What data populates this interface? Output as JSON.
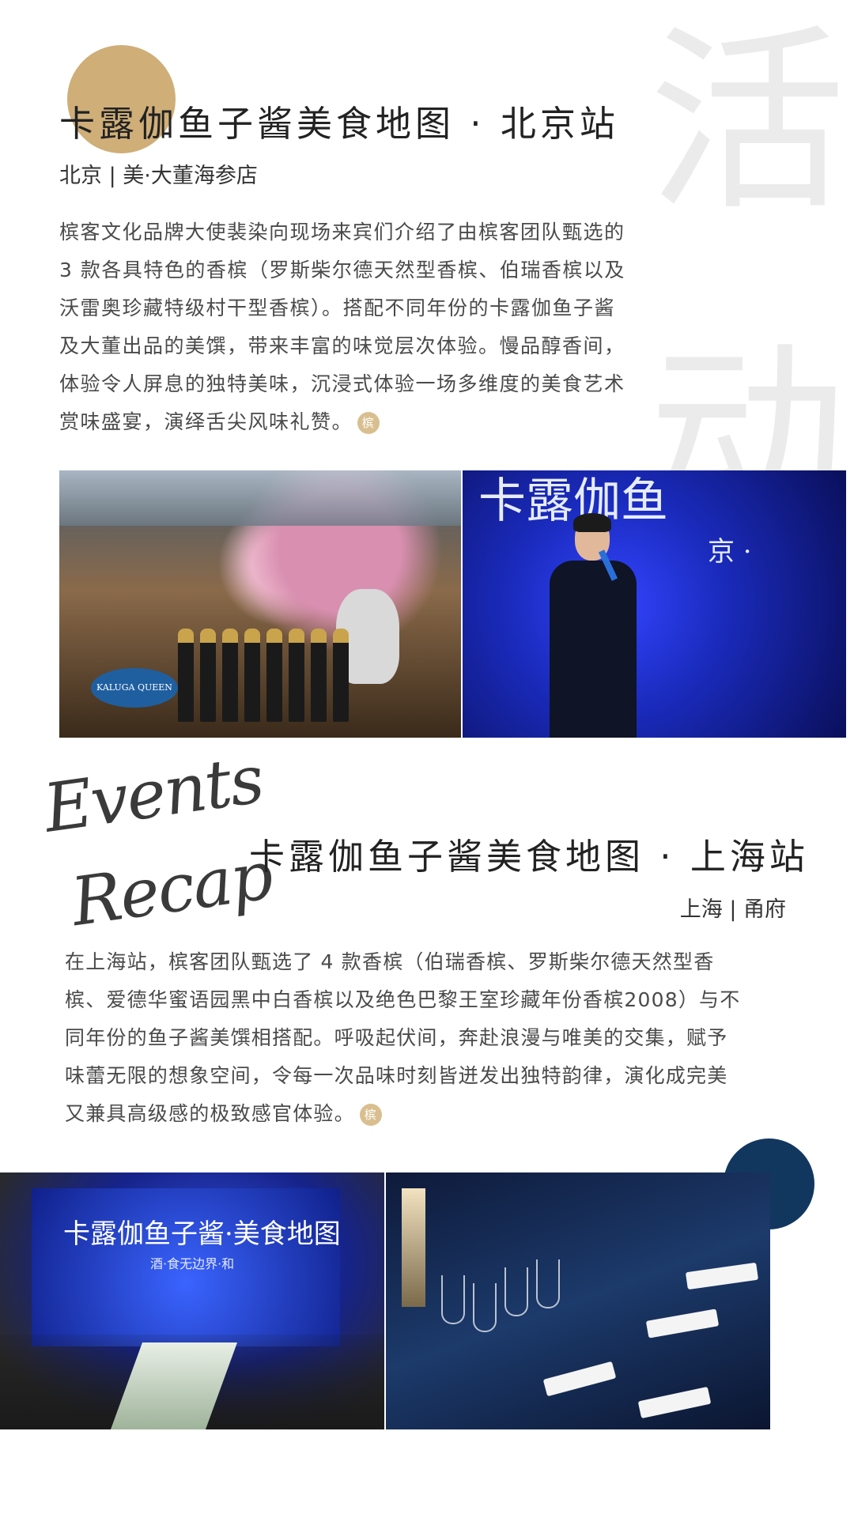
{
  "decor": {
    "watermark_chars": [
      "活",
      "动"
    ],
    "accent_gold": "#cfae78",
    "accent_navy": "#12375f"
  },
  "beijing": {
    "title": "卡露伽鱼子酱美食地图 · 北京站",
    "subtitle": "北京 | 美·大董海参店",
    "paragraph_lines": [
      "槟客文化品牌大使裴染向现场来宾们介绍了由槟客团队甄选的",
      "3 款各具特色的香槟（罗斯柴尔德天然型香槟、伯瑞香槟以及",
      "沃雷奥珍藏特级村干型香槟）。搭配不同年份的卡露伽鱼子酱",
      "及大董出品的美馔，带来丰富的味觉层次体验。慢品醇香间，",
      "体验令人屏息的独特美味，沉浸式体验一场多维度的美食艺术",
      "赏味盛宴，演绎舌尖风味礼赞。"
    ],
    "logo_mark": "槟",
    "photo_left_text": "KALUGA QUEEN",
    "photo_right_text": "卡露伽鱼",
    "photo_right_text2": "京 ·"
  },
  "signature": {
    "line1": "Events",
    "line2": "Recap"
  },
  "shanghai": {
    "title": "卡露伽鱼子酱美食地图 · 上海站",
    "subtitle": "上海 | 甬府",
    "paragraph_lines": [
      "在上海站，槟客团队甄选了 4 款香槟（伯瑞香槟、罗斯柴尔德天然型香",
      "槟、爱德华蜜语园黑中白香槟以及绝色巴黎王室珍藏年份香槟2008）与不",
      "同年份的鱼子酱美馔相搭配。呼吸起伏间，奔赴浪漫与唯美的交集，赋予",
      "味蕾无限的想象空间，令每一次品味时刻皆迸发出独特韵律，演化成完美",
      "又兼具高级感的极致感官体验。"
    ],
    "logo_mark": "槟",
    "screen_title": "卡露伽鱼子酱·美食地图",
    "screen_sub": "酒·食无边界·和"
  }
}
